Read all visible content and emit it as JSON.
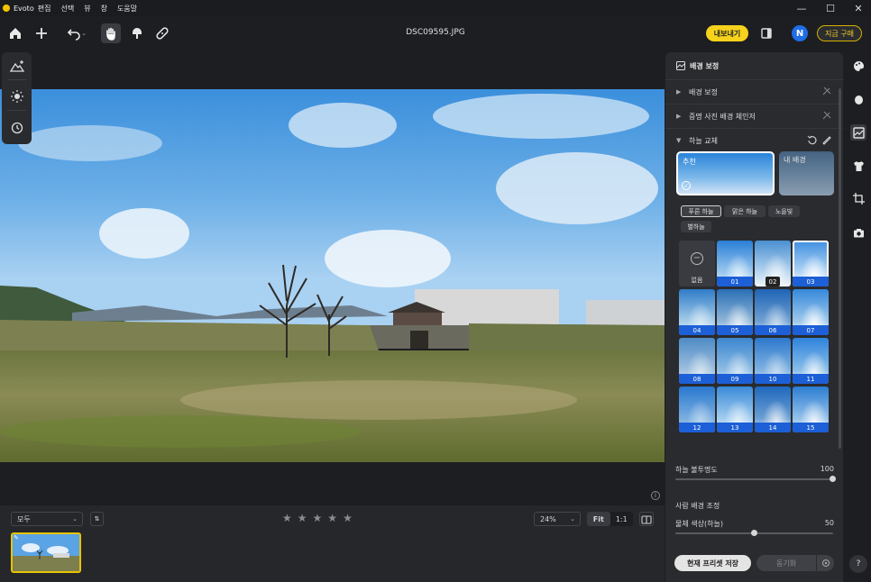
{
  "app": {
    "name": "Evoto"
  },
  "menu": [
    "편집",
    "선택",
    "뷰",
    "창",
    "도움말"
  ],
  "file": {
    "name": "DSC09595.JPG"
  },
  "toolbar": {
    "export_label": "내보내기",
    "avatar_letter": "N",
    "buy_label": "지금 구매"
  },
  "bottom": {
    "filter_value": "모두",
    "sort_label": "⇅",
    "stars": [
      "★",
      "★",
      "★",
      "★",
      "★"
    ],
    "zoom_value": "24%",
    "fit_label": "Fit",
    "one_label": "1:1"
  },
  "panel": {
    "title": "배경 보정",
    "sections": [
      {
        "label": "배경 보정"
      },
      {
        "label": "증명 사진 배경 체인저"
      },
      {
        "label": "하늘 교체"
      }
    ],
    "tabs": {
      "recommended": "추천",
      "mine": "내 배경"
    },
    "chips": [
      "푸른 하늘",
      "맑은 하늘",
      "노을빛",
      "별하늘"
    ],
    "none_label": "없음",
    "skies": [
      "01",
      "02",
      "03",
      "04",
      "05",
      "06",
      "07",
      "08",
      "09",
      "10",
      "11",
      "12",
      "13",
      "14",
      "15"
    ],
    "selected_sky": "03",
    "opacity": {
      "label": "하늘 불투명도",
      "value": "100",
      "fraction": 1.0
    },
    "people_title": "사람 배경 조정",
    "subject": {
      "label": "물체 색상(하늘)",
      "value": "50",
      "fraction": 0.5
    },
    "save_label": "현재 프리셋 저장",
    "sync_label": "동기화"
  },
  "help": {
    "label": "?"
  }
}
